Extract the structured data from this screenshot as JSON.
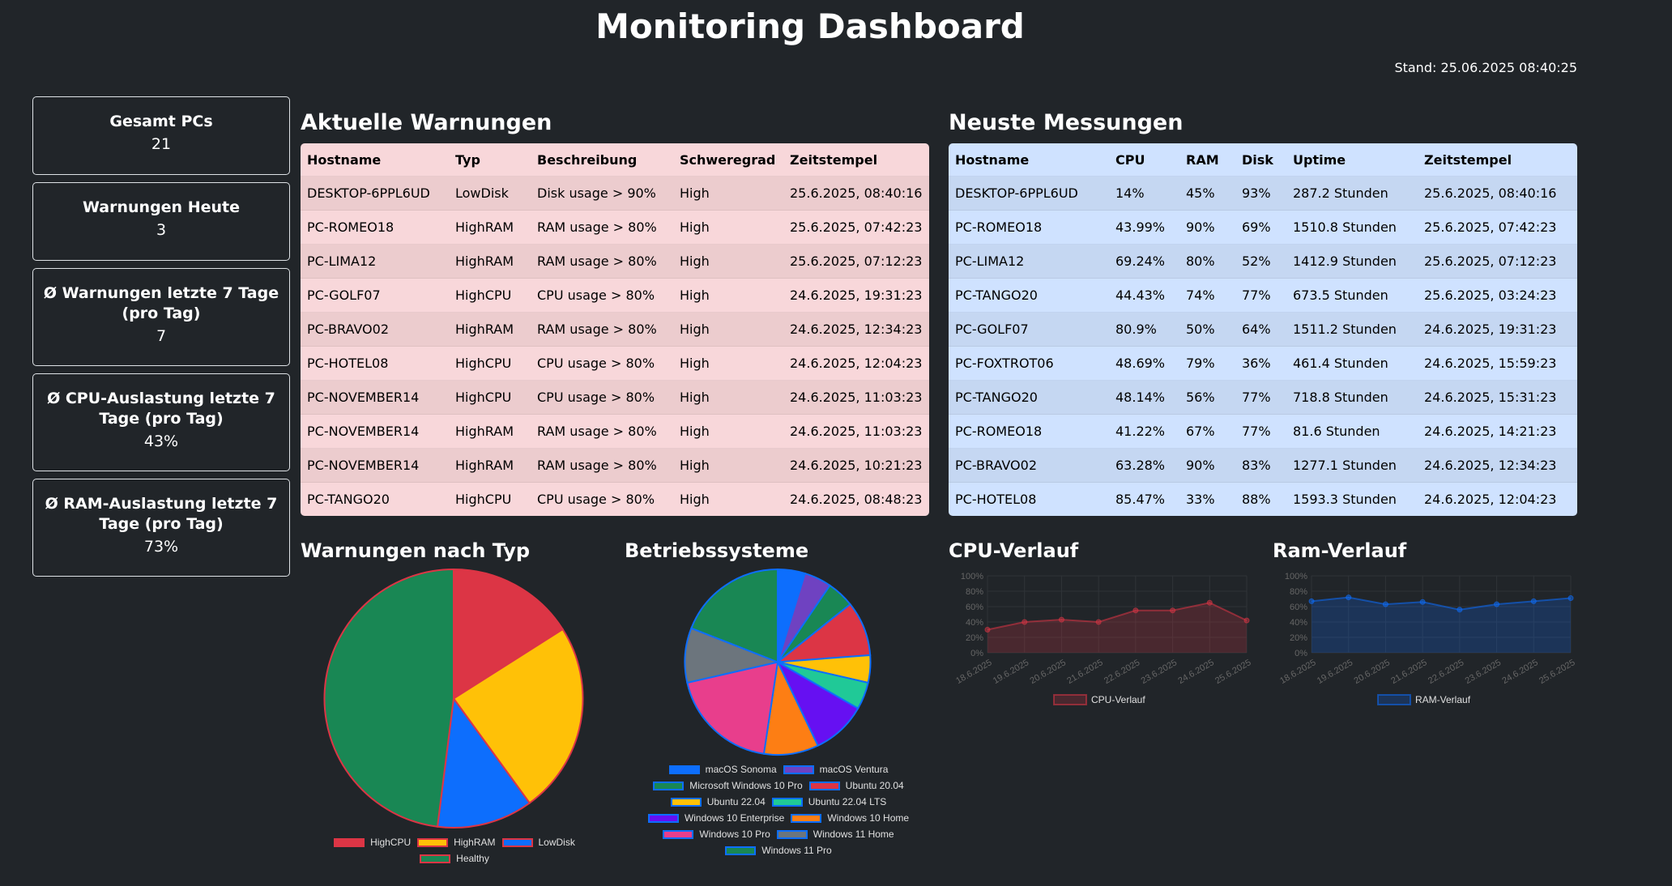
{
  "header": {
    "title": "Monitoring Dashboard",
    "timestamp": "Stand: 25.06.2025 08:40:25"
  },
  "stats": [
    {
      "label": "Gesamt PCs",
      "value": "21"
    },
    {
      "label": "Warnungen Heute",
      "value": "3"
    },
    {
      "label": "Ø Warnungen letzte 7 Tage (pro Tag)",
      "value": "7"
    },
    {
      "label": "Ø CPU-Auslastung letzte 7 Tage (pro Tag)",
      "value": "43%"
    },
    {
      "label": "Ø RAM-Auslastung letzte 7 Tage (pro Tag)",
      "value": "73%"
    }
  ],
  "warnings": {
    "title": "Aktuelle Warnungen",
    "headers": [
      "Hostname",
      "Typ",
      "Beschreibung",
      "Schweregrad",
      "Zeitstempel"
    ],
    "rows": [
      [
        "DESKTOP-6PPL6UD",
        "LowDisk",
        "Disk usage > 90%",
        "High",
        "25.6.2025, 08:40:16"
      ],
      [
        "PC-ROMEO18",
        "HighRAM",
        "RAM usage > 80%",
        "High",
        "25.6.2025, 07:42:23"
      ],
      [
        "PC-LIMA12",
        "HighRAM",
        "RAM usage > 80%",
        "High",
        "25.6.2025, 07:12:23"
      ],
      [
        "PC-GOLF07",
        "HighCPU",
        "CPU usage > 80%",
        "High",
        "24.6.2025, 19:31:23"
      ],
      [
        "PC-BRAVO02",
        "HighRAM",
        "RAM usage > 80%",
        "High",
        "24.6.2025, 12:34:23"
      ],
      [
        "PC-HOTEL08",
        "HighCPU",
        "CPU usage > 80%",
        "High",
        "24.6.2025, 12:04:23"
      ],
      [
        "PC-NOVEMBER14",
        "HighCPU",
        "CPU usage > 80%",
        "High",
        "24.6.2025, 11:03:23"
      ],
      [
        "PC-NOVEMBER14",
        "HighRAM",
        "RAM usage > 80%",
        "High",
        "24.6.2025, 11:03:23"
      ],
      [
        "PC-NOVEMBER14",
        "HighRAM",
        "RAM usage > 80%",
        "High",
        "24.6.2025, 10:21:23"
      ],
      [
        "PC-TANGO20",
        "HighCPU",
        "CPU usage > 80%",
        "High",
        "24.6.2025, 08:48:23"
      ]
    ]
  },
  "measurements": {
    "title": "Neuste Messungen",
    "headers": [
      "Hostname",
      "CPU",
      "RAM",
      "Disk",
      "Uptime",
      "Zeitstempel"
    ],
    "rows": [
      [
        "DESKTOP-6PPL6UD",
        "14%",
        "45%",
        "93%",
        "287.2 Stunden",
        "25.6.2025, 08:40:16"
      ],
      [
        "PC-ROMEO18",
        "43.99%",
        "90%",
        "69%",
        "1510.8 Stunden",
        "25.6.2025, 07:42:23"
      ],
      [
        "PC-LIMA12",
        "69.24%",
        "80%",
        "52%",
        "1412.9 Stunden",
        "25.6.2025, 07:12:23"
      ],
      [
        "PC-TANGO20",
        "44.43%",
        "74%",
        "77%",
        "673.5 Stunden",
        "25.6.2025, 03:24:23"
      ],
      [
        "PC-GOLF07",
        "80.9%",
        "50%",
        "64%",
        "1511.2 Stunden",
        "24.6.2025, 19:31:23"
      ],
      [
        "PC-FOXTROT06",
        "48.69%",
        "79%",
        "36%",
        "461.4 Stunden",
        "24.6.2025, 15:59:23"
      ],
      [
        "PC-TANGO20",
        "48.14%",
        "56%",
        "77%",
        "718.8 Stunden",
        "24.6.2025, 15:31:23"
      ],
      [
        "PC-ROMEO18",
        "41.22%",
        "67%",
        "77%",
        "81.6 Stunden",
        "24.6.2025, 14:21:23"
      ],
      [
        "PC-BRAVO02",
        "63.28%",
        "90%",
        "83%",
        "1277.1 Stunden",
        "24.6.2025, 12:34:23"
      ],
      [
        "PC-HOTEL08",
        "85.47%",
        "33%",
        "88%",
        "1593.3 Stunden",
        "24.6.2025, 12:04:23"
      ]
    ]
  },
  "chart_data": [
    {
      "type": "pie",
      "title": "Warnungen nach Typ",
      "categories": [
        "HighCPU",
        "HighRAM",
        "LowDisk",
        "Healthy"
      ],
      "values": [
        4,
        6,
        3,
        12
      ],
      "colors": [
        "#dc3545",
        "#ffc107",
        "#0d6efd",
        "#198754"
      ],
      "border": "#dc3545"
    },
    {
      "type": "pie",
      "title": "Betriebssysteme",
      "categories": [
        "macOS Sonoma",
        "macOS Ventura",
        "Microsoft Windows 10 Pro",
        "Ubuntu 20.04",
        "Ubuntu 22.04",
        "Ubuntu 22.04 LTS",
        "Windows 10 Enterprise",
        "Windows 10 Home",
        "Windows 10 Pro",
        "Windows 11 Home",
        "Windows 11 Pro"
      ],
      "values": [
        1,
        1,
        1,
        2,
        1,
        1,
        2,
        2,
        4,
        2,
        4
      ],
      "colors": [
        "#0d6efd",
        "#6f42c1",
        "#198754",
        "#dc3545",
        "#ffc107",
        "#20c997",
        "#6610f2",
        "#fd7e14",
        "#e83e8c",
        "#6c757d",
        "#198754"
      ],
      "border": "#0d6efd"
    },
    {
      "type": "area",
      "title": "CPU-Verlauf",
      "x": [
        "18.6.2025",
        "19.6.2025",
        "20.6.2025",
        "21.6.2025",
        "22.6.2025",
        "23.6.2025",
        "24.6.2025",
        "25.6.2025"
      ],
      "series": [
        {
          "name": "CPU-Verlauf",
          "values": [
            30,
            40,
            43,
            40,
            55,
            55,
            65,
            42
          ]
        }
      ],
      "ylim": [
        0,
        100
      ],
      "yticks": [
        "0%",
        "20%",
        "40%",
        "60%",
        "80%",
        "100%"
      ],
      "color": "#dc3545"
    },
    {
      "type": "area",
      "title": "Ram-Verlauf",
      "x": [
        "18.6.2025",
        "19.6.2025",
        "20.6.2025",
        "21.6.2025",
        "22.6.2025",
        "23.6.2025",
        "24.6.2025",
        "25.6.2025"
      ],
      "series": [
        {
          "name": "RAM-Verlauf",
          "values": [
            67,
            72,
            63,
            66,
            56,
            63,
            67,
            71
          ]
        }
      ],
      "ylim": [
        0,
        100
      ],
      "yticks": [
        "0%",
        "20%",
        "40%",
        "60%",
        "80%",
        "100%"
      ],
      "color": "#0d6efd"
    }
  ]
}
